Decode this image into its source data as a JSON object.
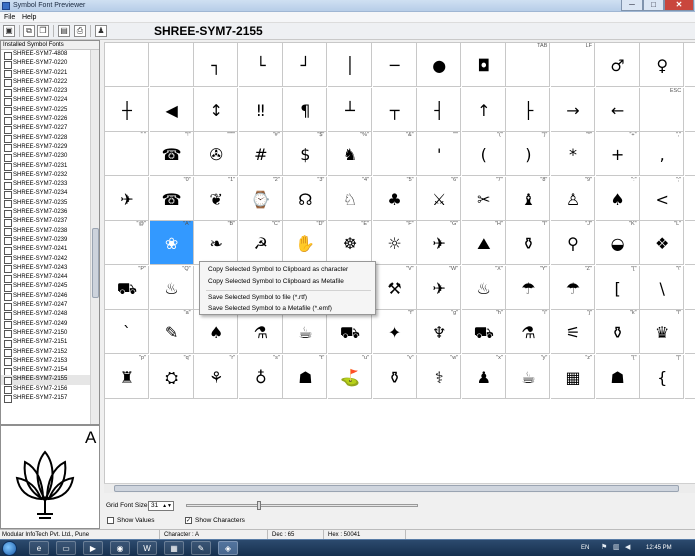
{
  "window": {
    "title": "Symbol Font Previewer",
    "minimize": "─",
    "maximize": "□",
    "close": "✕"
  },
  "menu": [
    "File",
    "Help"
  ],
  "toolbar": [
    {
      "name": "copy-doc-icon",
      "glyph": "▣"
    },
    {
      "name": "copy-clipboard-icon",
      "glyph": "⧉"
    },
    {
      "name": "copy-multiple-icon",
      "glyph": "❐"
    },
    {
      "name": "save-icon",
      "glyph": "▤"
    },
    {
      "name": "print-icon",
      "glyph": "⎙"
    },
    {
      "name": "help-user-icon",
      "glyph": "♟"
    }
  ],
  "font_title": "SHREE-SYM7-2155",
  "font_list": {
    "header": "Installed Symbol Fonts",
    "items": [
      "SHREE-SYM7-4808",
      "SHREE-SYM7-0220",
      "SHREE-SYM7-0221",
      "SHREE-SYM7-0222",
      "SHREE-SYM7-0223",
      "SHREE-SYM7-0224",
      "SHREE-SYM7-0225",
      "SHREE-SYM7-0226",
      "SHREE-SYM7-0227",
      "SHREE-SYM7-0228",
      "SHREE-SYM7-0229",
      "SHREE-SYM7-0230",
      "SHREE-SYM7-0231",
      "SHREE-SYM7-0232",
      "SHREE-SYM7-0233",
      "SHREE-SYM7-0234",
      "SHREE-SYM7-0235",
      "SHREE-SYM7-0236",
      "SHREE-SYM7-0237",
      "SHREE-SYM7-0238",
      "SHREE-SYM7-0239",
      "SHREE-SYM7-0241",
      "SHREE-SYM7-0242",
      "SHREE-SYM7-0243",
      "SHREE-SYM7-0244",
      "SHREE-SYM7-0245",
      "SHREE-SYM7-0246",
      "SHREE-SYM7-0247",
      "SHREE-SYM7-0248",
      "SHREE-SYM7-0249",
      "SHREE-SYM7-2150",
      "SHREE-SYM7-2151",
      "SHREE-SYM7-2152",
      "SHREE-SYM7-2153",
      "SHREE-SYM7-2154",
      "SHREE-SYM7-2155",
      "SHREE-SYM7-2156",
      "SHREE-SYM7-2157"
    ],
    "selected_index": 35
  },
  "preview": {
    "character": "A",
    "symbol": "lotus"
  },
  "grid": {
    "rows": [
      [
        {
          "l": "",
          "s": ""
        },
        {
          "l": "",
          "s": ""
        },
        {
          "l": "",
          "s": "┐"
        },
        {
          "l": "",
          "s": "└"
        },
        {
          "l": "",
          "s": "┘"
        },
        {
          "l": "",
          "s": "│"
        },
        {
          "l": "",
          "s": "─"
        },
        {
          "l": "",
          "s": "●"
        },
        {
          "l": "",
          "s": "◘"
        },
        {
          "l": "TAB",
          "s": ""
        },
        {
          "l": "LF",
          "s": ""
        },
        {
          "l": "",
          "s": "♂"
        },
        {
          "l": "",
          "s": "♀"
        },
        {
          "l": "",
          "s": ""
        }
      ],
      [
        {
          "l": "",
          "s": "┼"
        },
        {
          "l": "",
          "s": "◀"
        },
        {
          "l": "",
          "s": "↕"
        },
        {
          "l": "",
          "s": "‼"
        },
        {
          "l": "",
          "s": "¶"
        },
        {
          "l": "",
          "s": "┴"
        },
        {
          "l": "",
          "s": "┬"
        },
        {
          "l": "",
          "s": "┤"
        },
        {
          "l": "",
          "s": "↑"
        },
        {
          "l": "",
          "s": "├"
        },
        {
          "l": "",
          "s": "→"
        },
        {
          "l": "",
          "s": "←"
        },
        {
          "l": "ESC",
          "s": ""
        },
        {
          "l": "",
          "s": ""
        }
      ],
      [
        {
          "l": "\" \"",
          "s": ""
        },
        {
          "l": "\"!\"",
          "s": "☎"
        },
        {
          "l": "\"\"\"\"",
          "s": "✇"
        },
        {
          "l": "\"#\"",
          "s": "#"
        },
        {
          "l": "\"$\"",
          "s": "$"
        },
        {
          "l": "\"%\"",
          "s": "♞"
        },
        {
          "l": "\"&\"",
          "s": ""
        },
        {
          "l": "\"'\"",
          "s": "'"
        },
        {
          "l": "\"(\"",
          "s": "("
        },
        {
          "l": "\")\"",
          "s": ")"
        },
        {
          "l": "\"*\"",
          "s": "*"
        },
        {
          "l": "\"+\"",
          "s": "+"
        },
        {
          "l": "\",\"",
          "s": ","
        },
        {
          "l": "",
          "s": ""
        }
      ],
      [
        {
          "l": "",
          "s": "✈"
        },
        {
          "l": "\"0\"",
          "s": "☎"
        },
        {
          "l": "\"1\"",
          "s": "❦"
        },
        {
          "l": "\"2\"",
          "s": "⌚"
        },
        {
          "l": "\"3\"",
          "s": "☊"
        },
        {
          "l": "\"4\"",
          "s": "♘"
        },
        {
          "l": "\"5\"",
          "s": "♣"
        },
        {
          "l": "\"6\"",
          "s": "⚔"
        },
        {
          "l": "\"7\"",
          "s": "✂"
        },
        {
          "l": "\"8\"",
          "s": "♝"
        },
        {
          "l": "\"9\"",
          "s": "♙"
        },
        {
          "l": "\":\"",
          "s": "♠"
        },
        {
          "l": "\";\"",
          "s": "<"
        },
        {
          "l": "",
          "s": ""
        }
      ],
      [
        {
          "l": "\"@\"",
          "s": ""
        },
        {
          "l": "\"A\"",
          "s": "❀"
        },
        {
          "l": "\"B\"",
          "s": "❧"
        },
        {
          "l": "\"C\"",
          "s": "☭"
        },
        {
          "l": "\"D\"",
          "s": "✋"
        },
        {
          "l": "\"E\"",
          "s": "☸"
        },
        {
          "l": "\"F\"",
          "s": "☼"
        },
        {
          "l": "\"G\"",
          "s": "✈"
        },
        {
          "l": "\"H\"",
          "s": "⛰"
        },
        {
          "l": "\"I\"",
          "s": "⚱"
        },
        {
          "l": "\"J\"",
          "s": "⚲"
        },
        {
          "l": "\"K\"",
          "s": "◒"
        },
        {
          "l": "\"L\"",
          "s": "❖"
        },
        {
          "l": "",
          "s": ""
        }
      ],
      [
        {
          "l": "\"P\"",
          "s": "⛟"
        },
        {
          "l": "\"Q\"",
          "s": "♨"
        },
        {
          "l": "",
          "s": ""
        },
        {
          "l": "",
          "s": ""
        },
        {
          "l": "",
          "s": ""
        },
        {
          "l": "",
          "s": ""
        },
        {
          "l": "\"V\"",
          "s": "⚒"
        },
        {
          "l": "\"W\"",
          "s": "✈"
        },
        {
          "l": "\"X\"",
          "s": "♨"
        },
        {
          "l": "\"Y\"",
          "s": "☂"
        },
        {
          "l": "\"Z\"",
          "s": "☂"
        },
        {
          "l": "\"[\"",
          "s": "["
        },
        {
          "l": "\"\\\"",
          "s": "\\"
        },
        {
          "l": "",
          "s": ""
        }
      ],
      [
        {
          "l": "",
          "s": "`"
        },
        {
          "l": "\"a\"",
          "s": "✎"
        },
        {
          "l": "",
          "s": "♠"
        },
        {
          "l": "\"c\"",
          "s": "⚗"
        },
        {
          "l": "\"d\"",
          "s": "☕"
        },
        {
          "l": "\"e\"",
          "s": "⛟"
        },
        {
          "l": "\"f\"",
          "s": "✦"
        },
        {
          "l": "\"g\"",
          "s": "♆"
        },
        {
          "l": "\"h\"",
          "s": "⛟"
        },
        {
          "l": "\"i\"",
          "s": "⚗"
        },
        {
          "l": "\"j\"",
          "s": "⚟"
        },
        {
          "l": "\"k\"",
          "s": "⚱"
        },
        {
          "l": "\"l\"",
          "s": "♛"
        },
        {
          "l": "",
          "s": ""
        }
      ],
      [
        {
          "l": "\"p\"",
          "s": "♜"
        },
        {
          "l": "\"q\"",
          "s": "⛭"
        },
        {
          "l": "\"r\"",
          "s": "⚘"
        },
        {
          "l": "\"s\"",
          "s": "♁"
        },
        {
          "l": "\"t\"",
          "s": "☗"
        },
        {
          "l": "\"u\"",
          "s": "⛳"
        },
        {
          "l": "\"v\"",
          "s": "⚱"
        },
        {
          "l": "\"w\"",
          "s": "⚕"
        },
        {
          "l": "\"x\"",
          "s": "♟"
        },
        {
          "l": "\"y\"",
          "s": "☕"
        },
        {
          "l": "\"z\"",
          "s": "▦"
        },
        {
          "l": "\"{\"",
          "s": "☗"
        },
        {
          "l": "\"|\"",
          "s": "{"
        },
        {
          "l": "",
          "s": "|"
        }
      ]
    ],
    "selected": {
      "row": 4,
      "col": 1
    }
  },
  "context_menu": [
    "Copy Selected Symbol to Clipboard as character",
    "Copy Selected Symbol to Clipboard as Metafile",
    "Save Selected Symbol to file (*.rtf)",
    "Save Selected Symbol to a Metafile (*.emf)"
  ],
  "controls": {
    "grid_font_size_label": "Grid Font Size :",
    "grid_font_size_value": "31",
    "show_values_label": "Show Values",
    "show_values_checked": false,
    "show_characters_label": "Show Characters",
    "show_characters_checked": true
  },
  "status": {
    "company": "Modular InfoTech Pvt. Ltd., Pune",
    "character": "Character : A",
    "dec": "Dec : 65",
    "hex": "Hex : 50041"
  },
  "taskbar": {
    "apps": [
      {
        "name": "ie-icon",
        "glyph": "e"
      },
      {
        "name": "explorer-icon",
        "glyph": "▭"
      },
      {
        "name": "media-player-icon",
        "glyph": "▶"
      },
      {
        "name": "chrome-icon",
        "glyph": "◉"
      },
      {
        "name": "word-icon",
        "glyph": "W"
      },
      {
        "name": "app-icon",
        "glyph": "▦"
      },
      {
        "name": "paint-icon",
        "glyph": "✎"
      },
      {
        "name": "symbol-previewer-icon",
        "glyph": "◈"
      }
    ],
    "lang": "EN",
    "clock": "12:45 PM"
  }
}
